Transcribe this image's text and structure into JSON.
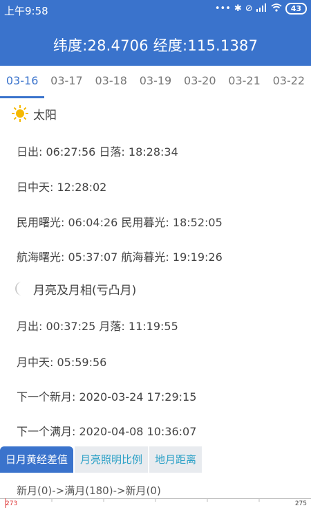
{
  "status": {
    "time": "上午9:58",
    "battery": "43"
  },
  "header": {
    "coords": "纬度:28.4706 经度:115.1387"
  },
  "date_tabs": [
    "03-16",
    "03-17",
    "03-18",
    "03-19",
    "03-20",
    "03-21",
    "03-22"
  ],
  "active_date_index": 0,
  "sun": {
    "title": "太阳",
    "rise_set": "日出: 06:27:56 日落: 18:28:34",
    "transit": "日中天: 12:28:02",
    "civil": "民用曙光: 06:04:26 民用暮光: 18:52:05",
    "nautical": "航海曙光: 05:37:07 航海暮光: 19:19:26"
  },
  "moon": {
    "title": "月亮及月相(亏凸月)",
    "rise_set": "月出: 00:37:25 月落: 11:19:55",
    "transit": "月中天: 05:59:56",
    "next_new": "下一个新月: 2020-03-24 17:29:15",
    "next_full": "下一个满月: 2020-04-08 10:36:07"
  },
  "bottom_tabs": [
    "日月黄经差值",
    "月亮照明比例",
    "地月距离"
  ],
  "active_bottom_index": 0,
  "phase_line": "新月(0)->满月(180)->新月(0)",
  "ruler": {
    "left_label": "273",
    "right_label": "275"
  },
  "colors": {
    "primary": "#3a73cc",
    "link": "#2aa0c6",
    "sun": "#f5b800",
    "moon": "#c9c9c9"
  }
}
